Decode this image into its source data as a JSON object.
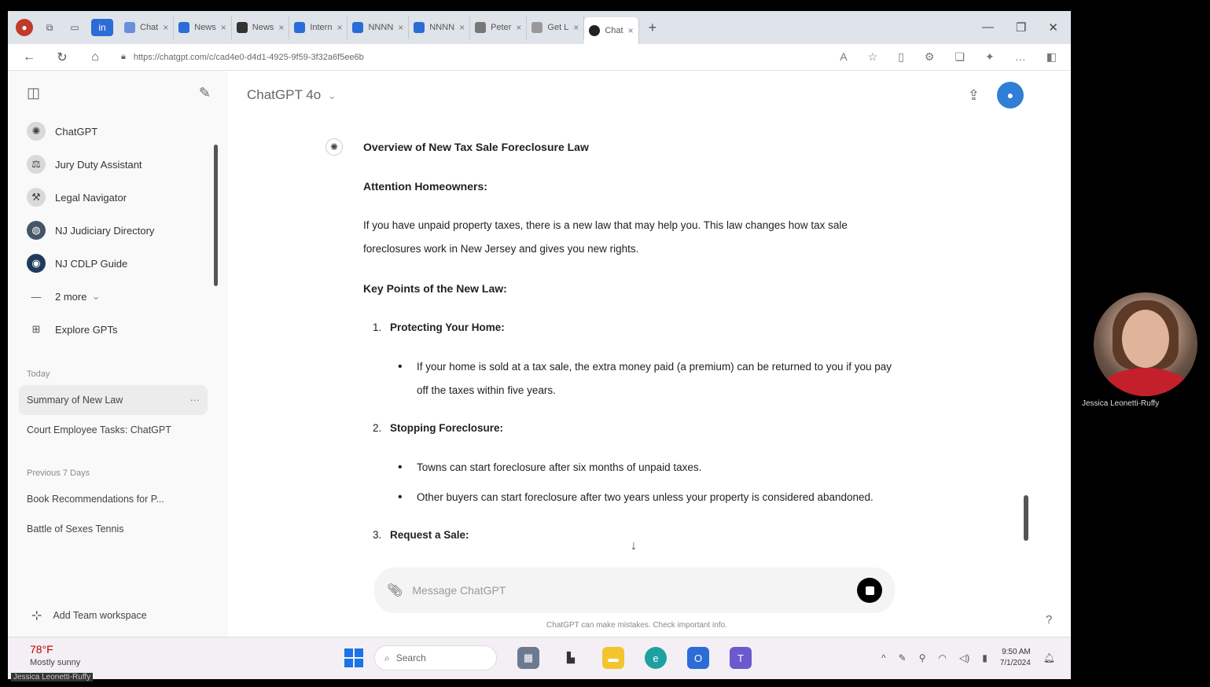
{
  "browser": {
    "tabs": [
      {
        "label": "Chat",
        "color": "#6a8fd8"
      },
      {
        "label": "News",
        "color": "#2b6cd6"
      },
      {
        "label": "News",
        "color": "#333333"
      },
      {
        "label": "Intern",
        "color": "#2b6cd6"
      },
      {
        "label": "NNNN",
        "color": "#2b6cd6"
      },
      {
        "label": "NNNN",
        "color": "#2b6cd6"
      },
      {
        "label": "Peter",
        "color": "#777777"
      },
      {
        "label": "Get L",
        "color": "#999999"
      }
    ],
    "active_tab": "Chat",
    "url": "https://chatgpt.com/c/cad4e0-d4d1-4925-9f59-3f32a6f5ee6b"
  },
  "sidebar": {
    "gpts": [
      {
        "label": "ChatGPT",
        "icon": "chatgpt-icon",
        "color": "#d9d9d9"
      },
      {
        "label": "Jury Duty Assistant",
        "icon": "scale-icon",
        "color": "#d9d9d9"
      },
      {
        "label": "Legal Navigator",
        "icon": "gavel-icon",
        "color": "#d9d9d9"
      },
      {
        "label": "NJ Judiciary Directory",
        "icon": "globe-icon",
        "color": "#445566"
      },
      {
        "label": "NJ CDLP Guide",
        "icon": "seal-icon",
        "color": "#1f3a5a"
      }
    ],
    "more_label": "2 more",
    "explore_label": "Explore GPTs",
    "section_today": "Today",
    "today_chats": [
      "Summary of New Law",
      "Court Employee Tasks: ChatGPT"
    ],
    "section_previous": "Previous 7 Days",
    "previous_chats": [
      "Book Recommendations for P...",
      "Battle of Sexes Tennis"
    ],
    "footer_label": "Add Team workspace"
  },
  "main": {
    "model_label": "ChatGPT 4o",
    "model_chevron": "⌄",
    "response": {
      "title": "Overview of New Tax Sale Foreclosure Law",
      "attention": "Attention Homeowners:",
      "intro": "If you have unpaid property taxes, there is a new law that may help you. This law changes how tax sale foreclosures work in New Jersey and gives you new rights.",
      "key_points_heading": "Key Points of the New Law:",
      "items": [
        {
          "num": "1.",
          "title": "Protecting Your Home:",
          "bullets": [
            "If your home is sold at a tax sale, the extra money paid (a premium) can be returned to you if you pay off the taxes within five years."
          ]
        },
        {
          "num": "2.",
          "title": "Stopping Foreclosure:",
          "bullets": [
            "Towns can start foreclosure after six months of unpaid taxes.",
            "Other buyers can start foreclosure after two years unless your property is considered abandoned."
          ]
        },
        {
          "num": "3.",
          "title": "Request a Sale:",
          "bullets": []
        }
      ]
    },
    "composer_placeholder": "Message ChatGPT",
    "disclaimer": "ChatGPT can make mistakes. Check important info.",
    "help_label": "?"
  },
  "taskbar": {
    "weather_temp": "78°F",
    "weather_desc": "Mostly sunny",
    "search_placeholder": "Search",
    "time": "9:50 AM",
    "date": "7/1/2024"
  },
  "webcam": {
    "name": "Jessica Leonetti-Ruffy"
  },
  "presenter_label": "Jessica Leonetti-Ruffy"
}
